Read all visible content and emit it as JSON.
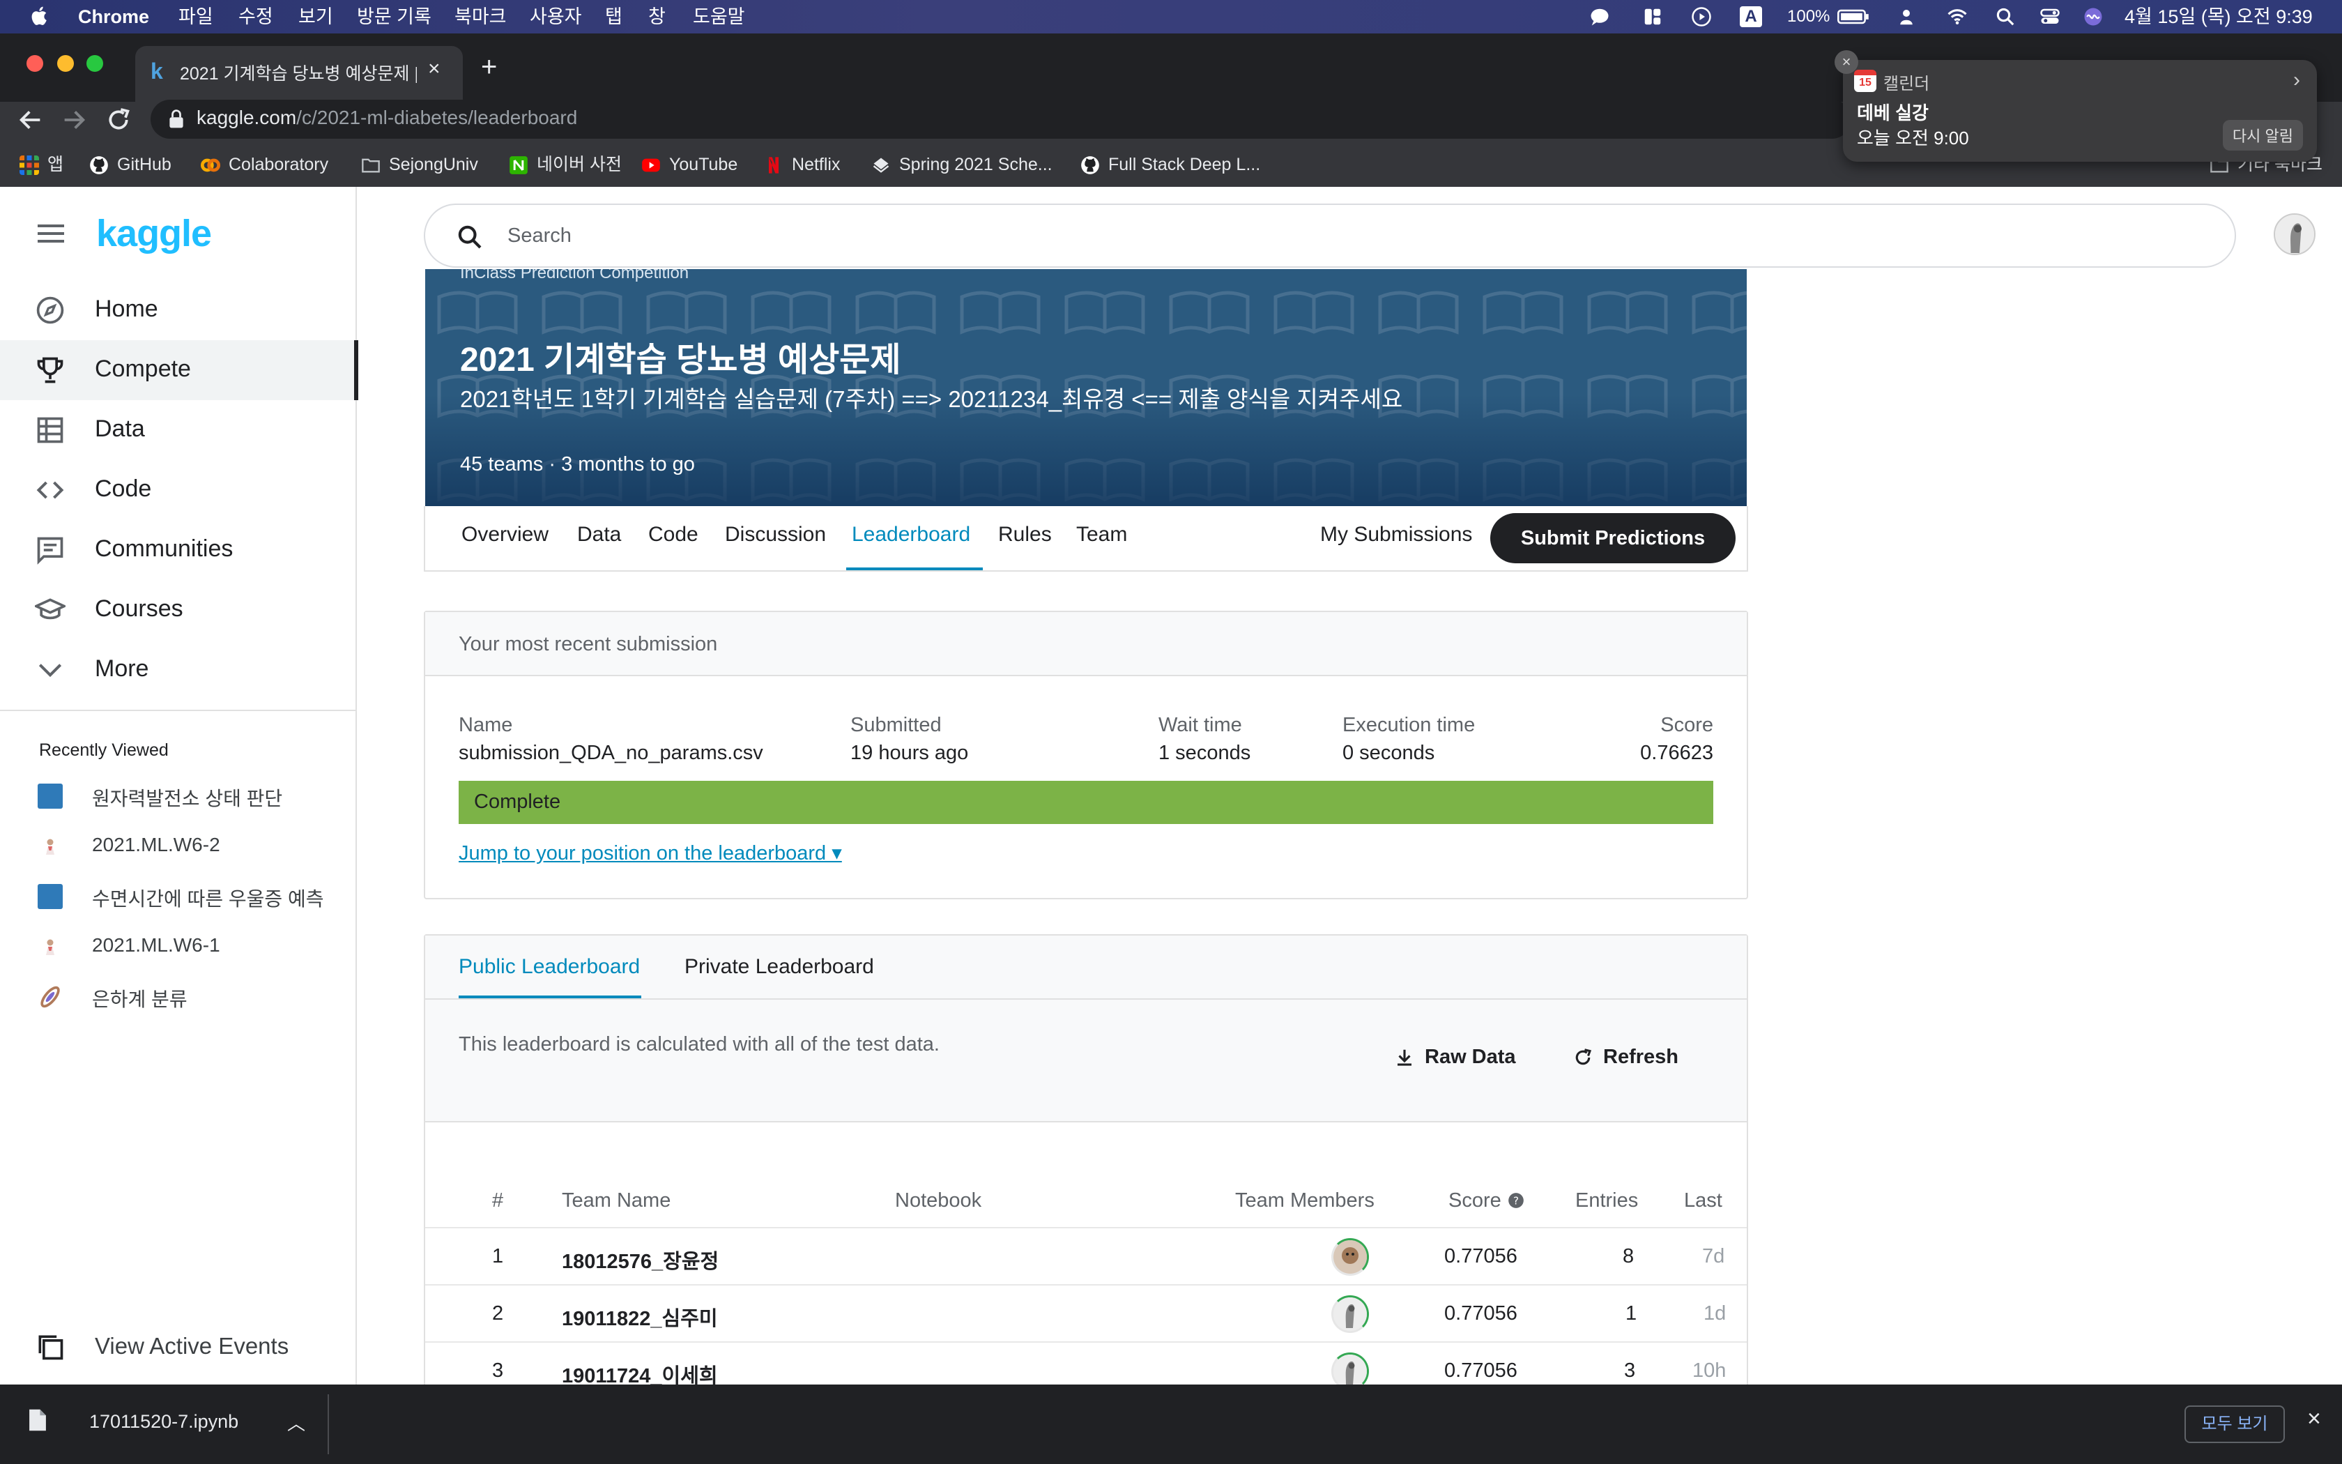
{
  "menubar": {
    "app": "Chrome",
    "items": [
      "파일",
      "수정",
      "보기",
      "방문 기록",
      "북마크",
      "사용자",
      "탭",
      "창",
      "도움말"
    ],
    "battery": "100%",
    "datetime": "4월 15일 (목) 오전 9:39",
    "input_badge": "A"
  },
  "browser": {
    "tab_title": "2021 기계학습 당뇨병 예상문제 | Ka",
    "tab_favicon": "k",
    "url_host": "kaggle.com",
    "url_path": "/c/2021-ml-diabetes/leaderboard",
    "bookmarks": [
      {
        "label": "앱",
        "icon": "apps-grid-icon",
        "color": "#e8710a"
      },
      {
        "label": "GitHub",
        "icon": "github-icon",
        "color": "#ffffff"
      },
      {
        "label": "Colaboratory",
        "icon": "colab-icon",
        "color": "#f9ab00"
      },
      {
        "label": "SejongUniv",
        "icon": "folder-icon",
        "color": "#9aa0a6"
      },
      {
        "label": "네이버 사전",
        "icon": "naver-dict-icon",
        "color": "#2db400"
      },
      {
        "label": "YouTube",
        "icon": "youtube-icon",
        "color": "#ff0000"
      },
      {
        "label": "Netflix",
        "icon": "netflix-icon",
        "color": "#e50914"
      },
      {
        "label": "Spring 2021 Sche...",
        "icon": "spring-icon",
        "color": "#ffffff"
      },
      {
        "label": "Full Stack Deep L...",
        "icon": "github-icon",
        "color": "#ffffff"
      }
    ],
    "bookmark_overflow": "기타 북마크"
  },
  "notification": {
    "app": "캘린더",
    "cal_day": "15",
    "title": "데베 실강",
    "time": "오늘 오전 9:00",
    "snooze": "다시 알림"
  },
  "sidebar": {
    "logo": "kaggle",
    "nav": [
      {
        "label": "Home",
        "icon": "compass-icon",
        "active": false
      },
      {
        "label": "Compete",
        "icon": "trophy-icon",
        "active": true
      },
      {
        "label": "Data",
        "icon": "table-icon",
        "active": false
      },
      {
        "label": "Code",
        "icon": "code-icon",
        "active": false
      },
      {
        "label": "Communities",
        "icon": "chat-icon",
        "active": false
      },
      {
        "label": "Courses",
        "icon": "school-icon",
        "active": false
      },
      {
        "label": "More",
        "icon": "chevron-down-icon",
        "active": false
      }
    ],
    "recently_viewed_title": "Recently Viewed",
    "recently_viewed": [
      {
        "label": "원자력발전소 상태 판단",
        "icon": "blue-square-icon"
      },
      {
        "label": "2021.ML.W6-2",
        "icon": "person-thumb-icon"
      },
      {
        "label": "수면시간에 따른 우울증 예측",
        "icon": "blue-square-icon"
      },
      {
        "label": "2021.ML.W6-1",
        "icon": "person-thumb-icon"
      },
      {
        "label": "은하계 분류",
        "icon": "galaxy-icon"
      }
    ],
    "view_active_events": "View Active Events"
  },
  "search": {
    "placeholder": "Search"
  },
  "competition": {
    "kind": "InClass Prediction Competition",
    "title": "2021 기계학습 당뇨병 예상문제",
    "subtitle": "2021학년도 1학기 기계학습 실습문제 (7주차) ==> 20211234_최유경 <== 제출 양식을 지켜주세요",
    "teams": "45 teams",
    "time_left": "3 months to go",
    "tabs": [
      "Overview",
      "Data",
      "Code",
      "Discussion",
      "Leaderboard",
      "Rules",
      "Team"
    ],
    "active_tab": "Leaderboard",
    "my_submissions": "My Submissions",
    "submit_predictions": "Submit Predictions"
  },
  "recent_submission": {
    "header": "Your most recent submission",
    "name_label": "Name",
    "name": "submission_QDA_no_params.csv",
    "submitted_label": "Submitted",
    "submitted": "19 hours ago",
    "wait_label": "Wait time",
    "wait": "1 seconds",
    "exec_label": "Execution time",
    "exec": "0 seconds",
    "score_label": "Score",
    "score": "0.76623",
    "status": "Complete",
    "status_color": "#7cb347",
    "jump_link": "Jump to your position on the leaderboard ▾"
  },
  "leaderboard": {
    "tabs": [
      "Public Leaderboard",
      "Private Leaderboard"
    ],
    "active_tab": "Public Leaderboard",
    "description": "This leaderboard is calculated with all of the test data.",
    "raw_data": "Raw Data",
    "refresh": "Refresh",
    "columns": [
      "#",
      "Team Name",
      "Notebook",
      "Team Members",
      "Score",
      "Entries",
      "Last"
    ],
    "rows": [
      {
        "rank": "1",
        "team": "18012576_장윤정",
        "score": "0.77056",
        "entries": "8",
        "last": "7d"
      },
      {
        "rank": "2",
        "team": "19011822_심주미",
        "score": "0.77056",
        "entries": "1",
        "last": "1d"
      },
      {
        "rank": "3",
        "team": "19011724_이세희",
        "score": "0.77056",
        "entries": "3",
        "last": "10h"
      }
    ]
  },
  "downloads": {
    "file": "17011520-7.ipynb",
    "show_all": "모두 보기"
  }
}
